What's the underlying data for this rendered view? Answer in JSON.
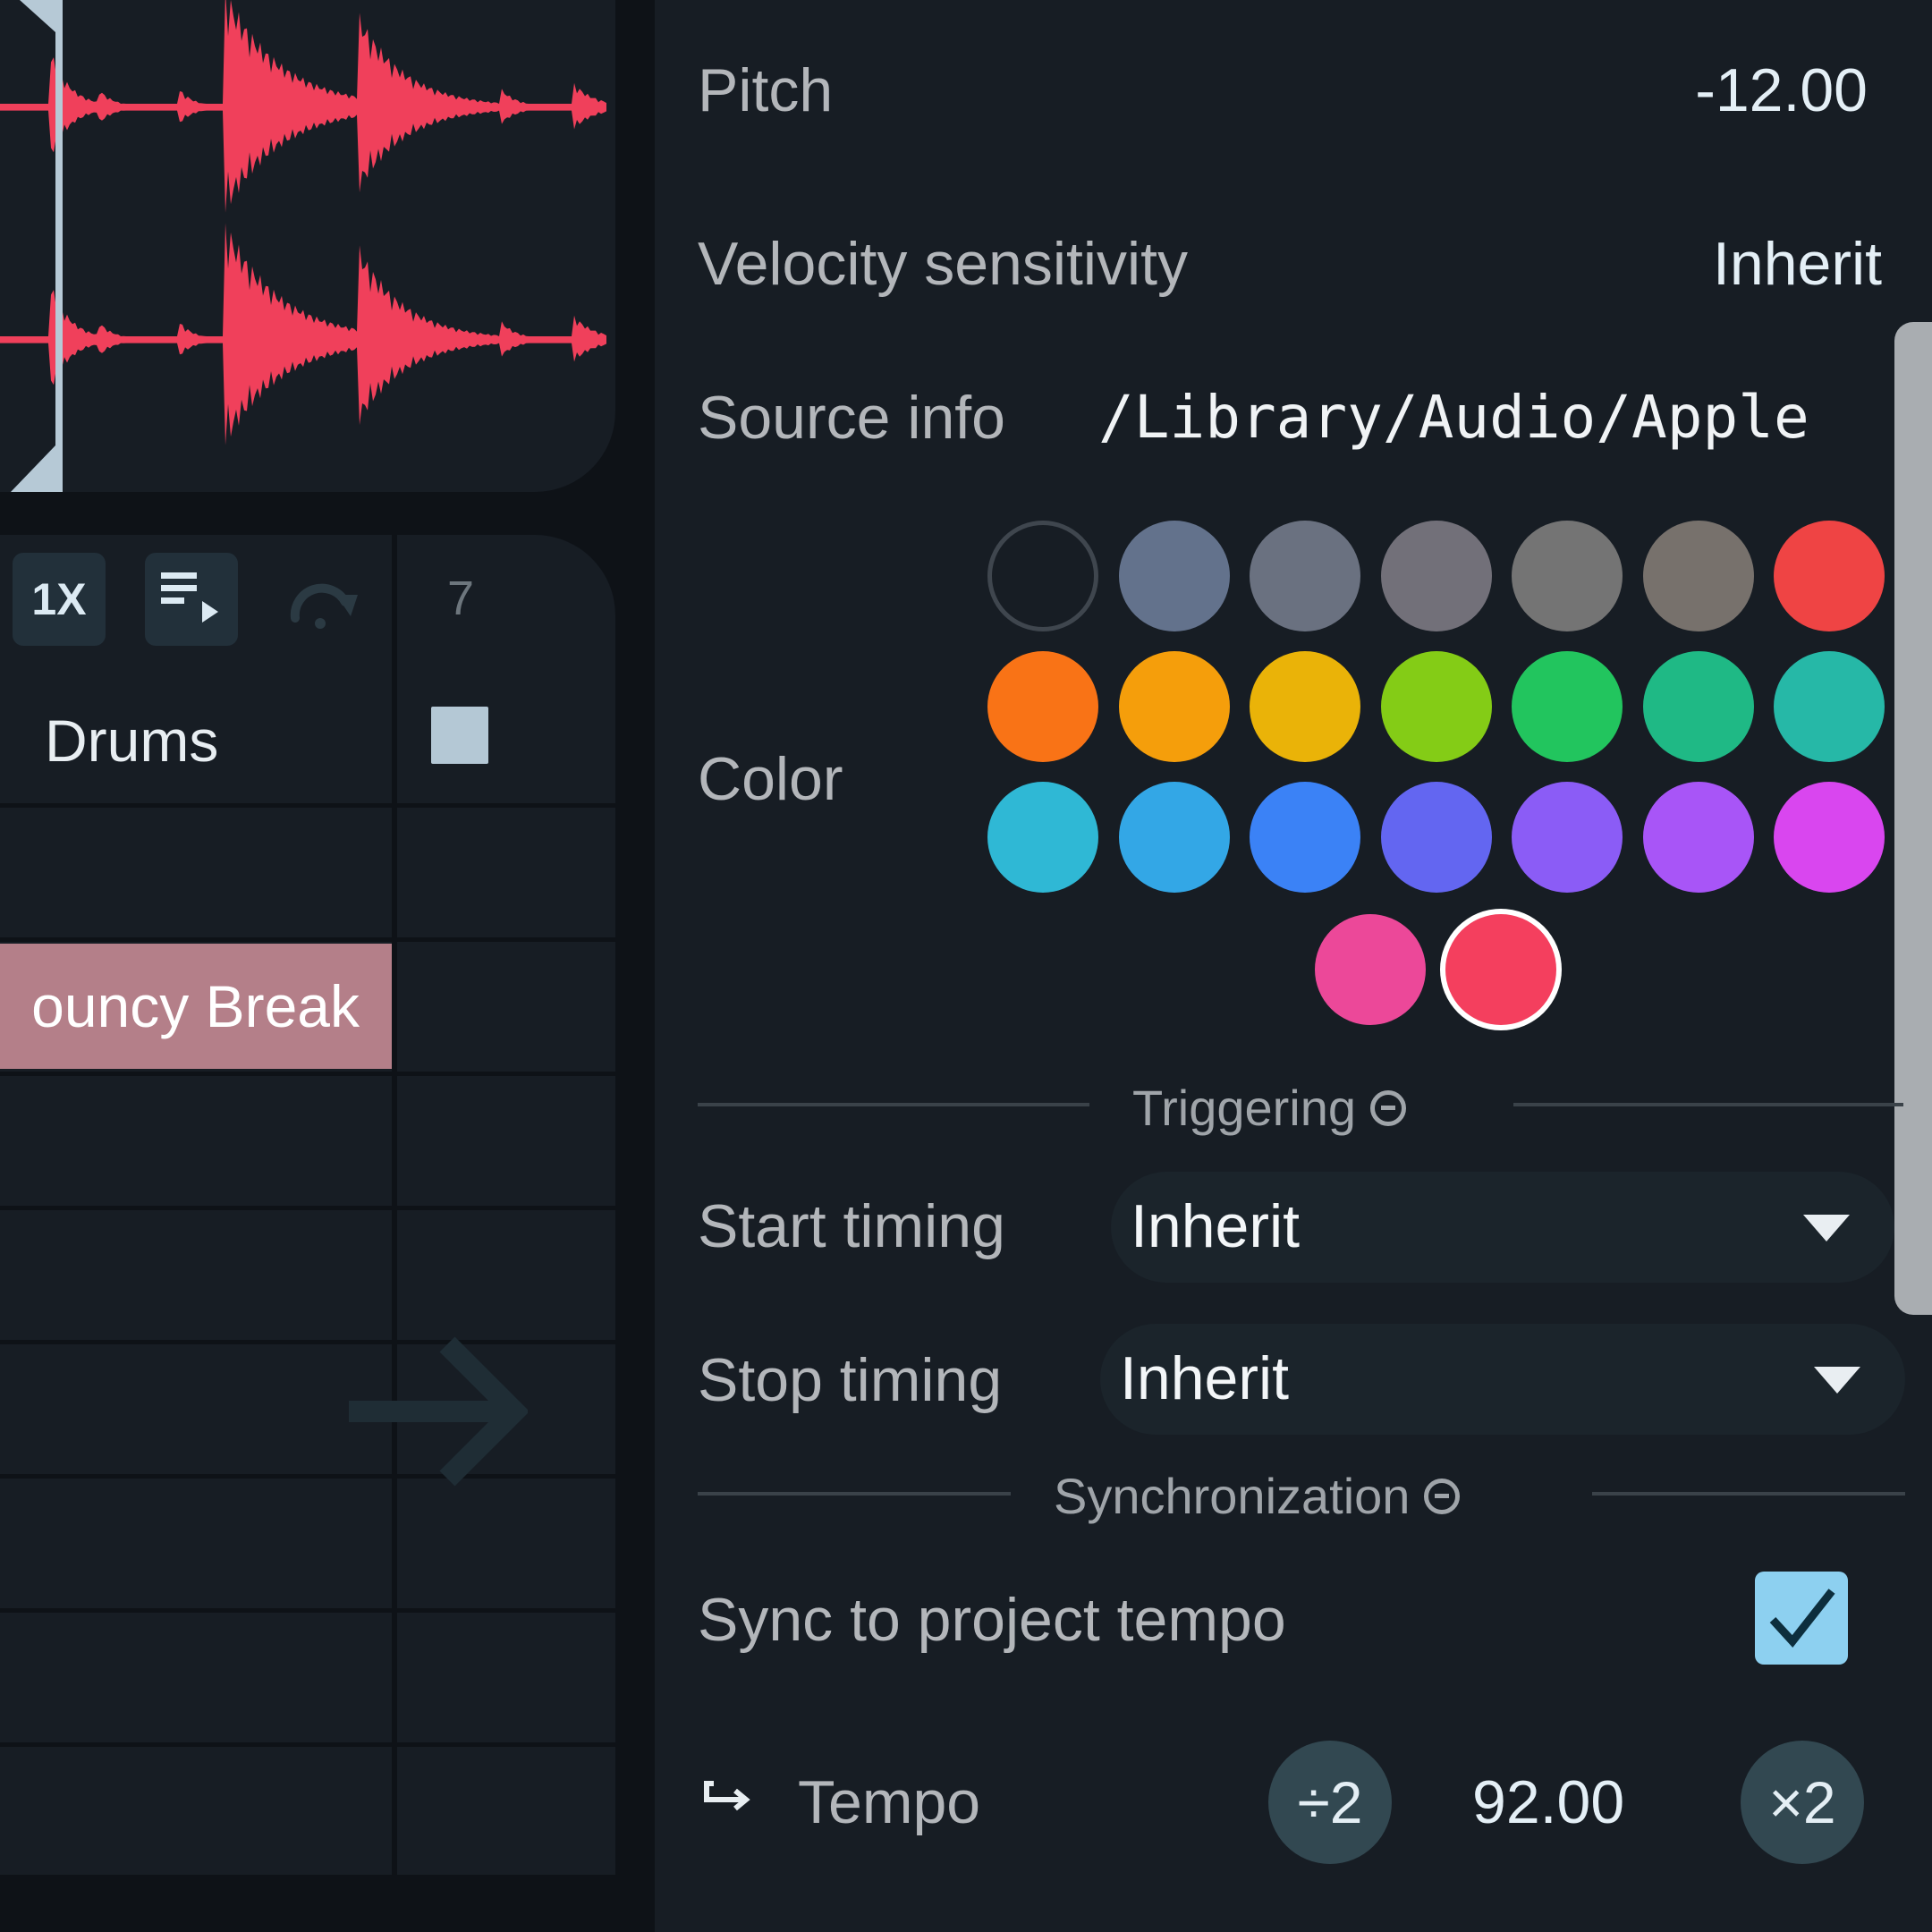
{
  "clip_editor": {
    "waveform": {
      "color": "#f0405b",
      "channels": 2
    },
    "toolbar": {
      "speed_label": "1X",
      "launch_mode_icon": "playlist-play-icon",
      "loop_icon": "redo-loop-icon",
      "scene_number": "7"
    },
    "track": {
      "name": "Drums",
      "stop_icon": "stop-square-icon"
    },
    "clip": {
      "name": "Bouncy Break",
      "visible_name": "ouncy Break",
      "color": "#b47f89"
    },
    "drop_hint_icon": "arrow-right-icon"
  },
  "inspector": {
    "pitch": {
      "label": "Pitch",
      "value": "-12.00"
    },
    "velocity": {
      "label": "Velocity sensitivity",
      "value": "Inherit"
    },
    "source": {
      "label": "Source info",
      "value": "/Library/Audio/Apple"
    },
    "color": {
      "label": "Color",
      "swatches": [
        {
          "name": "none",
          "hex": ""
        },
        {
          "name": "slate",
          "hex": "#63728c"
        },
        {
          "name": "gray-blue",
          "hex": "#6a7180"
        },
        {
          "name": "zinc",
          "hex": "#727079"
        },
        {
          "name": "neutral",
          "hex": "#747474"
        },
        {
          "name": "stone",
          "hex": "#77716c"
        },
        {
          "name": "red",
          "hex": "#ef4444"
        },
        {
          "name": "orange",
          "hex": "#f97316"
        },
        {
          "name": "amber",
          "hex": "#f59e0b"
        },
        {
          "name": "yellow",
          "hex": "#eab308"
        },
        {
          "name": "lime",
          "hex": "#84cc16"
        },
        {
          "name": "green",
          "hex": "#22c55e"
        },
        {
          "name": "emerald",
          "hex": "#1fb985"
        },
        {
          "name": "teal",
          "hex": "#26b8a7"
        },
        {
          "name": "cyan",
          "hex": "#2fb8d5"
        },
        {
          "name": "sky",
          "hex": "#33a7e6"
        },
        {
          "name": "blue",
          "hex": "#3b82f6"
        },
        {
          "name": "indigo",
          "hex": "#6366f1"
        },
        {
          "name": "violet",
          "hex": "#8b5cf6"
        },
        {
          "name": "purple",
          "hex": "#a855f7"
        },
        {
          "name": "fuchsia",
          "hex": "#d946ef"
        },
        {
          "name": "pink",
          "hex": "#ec4899"
        },
        {
          "name": "rose",
          "hex": "#f43f5e"
        }
      ],
      "selected": "rose"
    },
    "triggering": {
      "title": "Triggering",
      "start_timing": {
        "label": "Start timing",
        "value": "Inherit"
      },
      "stop_timing": {
        "label": "Stop timing",
        "value": "Inherit"
      }
    },
    "synchronization": {
      "title": "Synchronization",
      "sync_tempo": {
        "label": "Sync to project tempo",
        "checked": true
      },
      "tempo": {
        "label": "Tempo",
        "icon": "return-arrow-icon",
        "value": "92.00",
        "halve_label": "÷2",
        "double_label": "×2"
      }
    }
  }
}
